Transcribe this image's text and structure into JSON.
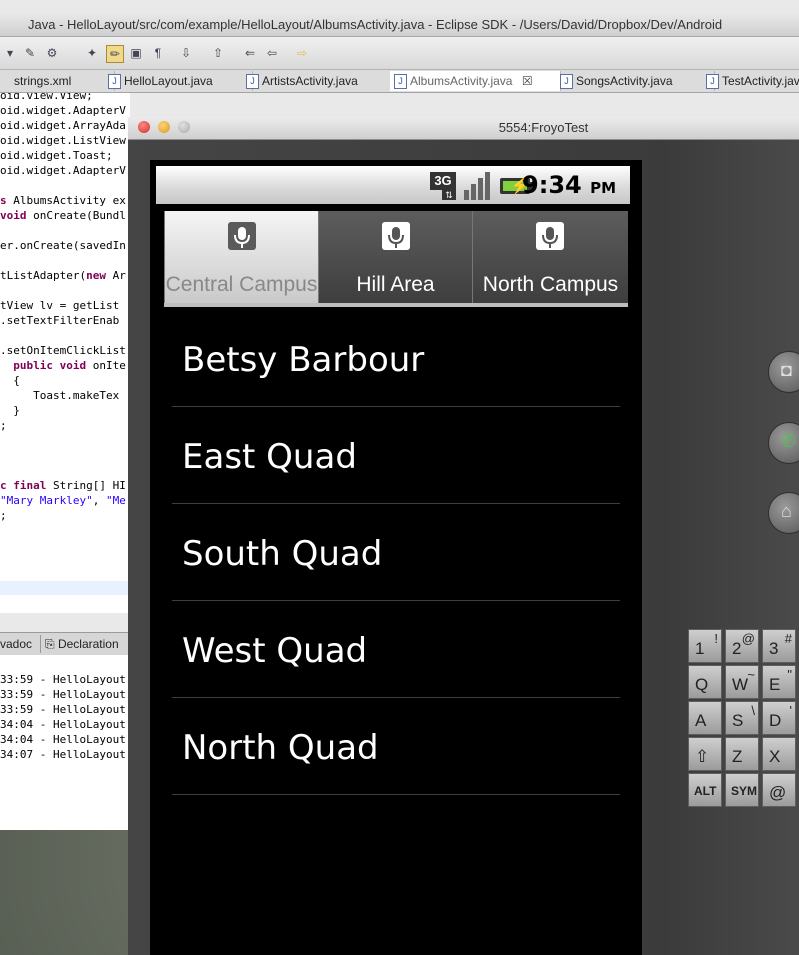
{
  "eclipse": {
    "title": "Java - HelloLayout/src/com/example/HelloLayout/AlbumsActivity.java - Eclipse SDK - /Users/David/Dropbox/Dev/Android",
    "tabs": [
      {
        "label": "strings.xml"
      },
      {
        "label": "HelloLayout.java"
      },
      {
        "label": "ArtistsActivity.java"
      },
      {
        "label": "AlbumsActivity.java",
        "active": true
      },
      {
        "label": "SongsActivity.java"
      },
      {
        "label": "TestActivity.java"
      }
    ],
    "code_lines": [
      "oid.view.View;",
      "oid.widget.AdapterV",
      "oid.widget.ArrayAda",
      "oid.widget.ListView",
      "oid.widget.Toast;",
      "oid.widget.AdapterV",
      "",
      "s AlbumsActivity ex",
      "void onCreate(Bundl",
      "",
      "er.onCreate(savedIn",
      "",
      "tListAdapter(new Ar",
      "",
      "tView lv = getList",
      ".setTextFilterEnab",
      "",
      ".setOnItemClickList",
      "  public void onIte",
      "  {",
      "     Toast.makeTex",
      "  }",
      ";",
      "",
      "",
      "",
      "c final String[] HI",
      "\"Mary Markley\", \"Me",
      ";"
    ],
    "panel_tabs": [
      "vadoc",
      "Declaration"
    ],
    "console_lines": [
      "33:59 - HelloLayout",
      "33:59 - HelloLayout",
      "33:59 - HelloLayout",
      "34:04 - HelloLayout",
      "34:04 - HelloLayout",
      "34:07 - HelloLayout"
    ]
  },
  "emulator": {
    "title": "5554:FroyoTest",
    "status_bar": {
      "network": "3G",
      "time": "9:34",
      "ampm": "PM"
    },
    "tabs": [
      {
        "label": "Central Campus",
        "icon": "microphone-icon",
        "selected": true
      },
      {
        "label": "Hill Area",
        "icon": "microphone-icon",
        "selected": false
      },
      {
        "label": "North Campus",
        "icon": "microphone-icon",
        "selected": false
      }
    ],
    "list_items": [
      "Betsy Barbour",
      "East Quad",
      "South Quad",
      "West Quad",
      "North Quad"
    ],
    "keyboard": [
      {
        "main": "1",
        "alt": "!"
      },
      {
        "main": "2",
        "alt": "@"
      },
      {
        "main": "3",
        "alt": "#"
      },
      {
        "main": "Q",
        "alt": ""
      },
      {
        "main": "W",
        "alt": "~"
      },
      {
        "main": "E",
        "alt": "\""
      },
      {
        "main": "A",
        "alt": ""
      },
      {
        "main": "S",
        "alt": "\\"
      },
      {
        "main": "D",
        "alt": "'"
      },
      {
        "main": "⇧",
        "alt": ""
      },
      {
        "main": "Z",
        "alt": ""
      },
      {
        "main": "X",
        "alt": ""
      },
      {
        "main": "ALT",
        "alt": ""
      },
      {
        "main": "SYM",
        "alt": ""
      },
      {
        "main": "@",
        "alt": ""
      }
    ]
  }
}
